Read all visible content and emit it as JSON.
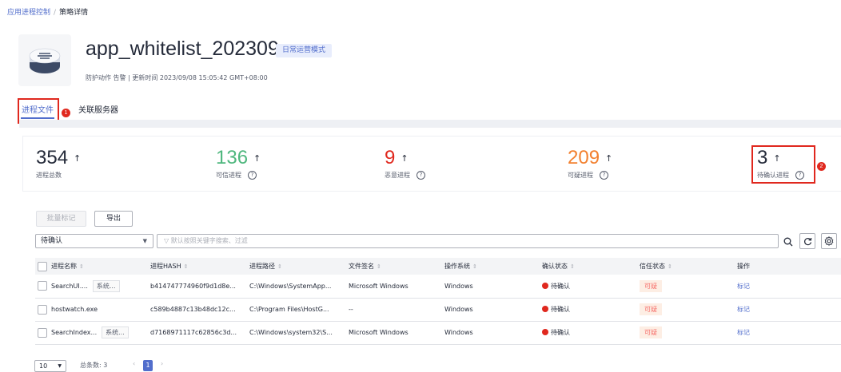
{
  "breadcrumb": {
    "parent": "应用进程控制",
    "separator": "/",
    "current": "策略详情"
  },
  "header": {
    "title": "app_whitelist_202309",
    "mode_tag": "日常运营模式",
    "meta": "防护动作 告警 | 更新时间 2023/09/08 15:05:42 GMT+08:00"
  },
  "tabs": [
    {
      "label": "进程文件",
      "active": true
    },
    {
      "label": "关联服务器",
      "active": false
    }
  ],
  "annotations": {
    "badge1": "1",
    "badge2": "2"
  },
  "stats": [
    {
      "value": "354",
      "label": "进程总数",
      "color": "#252b3a",
      "help": false
    },
    {
      "value": "136",
      "label": "可信进程",
      "color": "#4fb77e",
      "help": true
    },
    {
      "value": "9",
      "label": "恶意进程",
      "color": "#e0281e",
      "help": true
    },
    {
      "value": "209",
      "label": "可疑进程",
      "color": "#f2802f",
      "help": true
    },
    {
      "value": "3",
      "label": "待确认进程",
      "color": "#252b3a",
      "help": true
    }
  ],
  "stat_arrow": "↑",
  "help_icon": "?",
  "toolbar": {
    "batch_label": "批量标记",
    "export_label": "导出"
  },
  "filter": {
    "select_value": "待确认",
    "search_placeholder": "默认按照关键字搜索、过滤"
  },
  "table": {
    "columns": [
      "进程名称",
      "进程HASH",
      "进程路径",
      "文件签名",
      "操作系统",
      "确认状态",
      "信任状态",
      "操作"
    ],
    "rows": [
      {
        "name": "SearchUI....",
        "tag": "系统...",
        "hash": "b414747774960f9d1d8e...",
        "path": "C:\\Windows\\SystemApp...",
        "signature": "Microsoft Windows",
        "os": "Windows",
        "confirm": "待确认",
        "trust": "可疑",
        "action": "标记"
      },
      {
        "name": "hostwatch.exe",
        "tag": "",
        "hash": "c589b4887c13b48dc12c...",
        "path": "C:\\Program Files\\HostG...",
        "signature": "--",
        "os": "Windows",
        "confirm": "待确认",
        "trust": "可疑",
        "action": "标记"
      },
      {
        "name": "SearchIndex...",
        "tag": "系统...",
        "hash": "d7168971117c62856c3d...",
        "path": "C:\\Windows\\system32\\S...",
        "signature": "Microsoft Windows",
        "os": "Windows",
        "confirm": "待确认",
        "trust": "可疑",
        "action": "标记"
      }
    ]
  },
  "pagination": {
    "page_size": "10",
    "total": "总条数: 3",
    "current_page": "1"
  },
  "colors": {
    "accent": "#526ecc",
    "highlight": "#e0281e"
  }
}
